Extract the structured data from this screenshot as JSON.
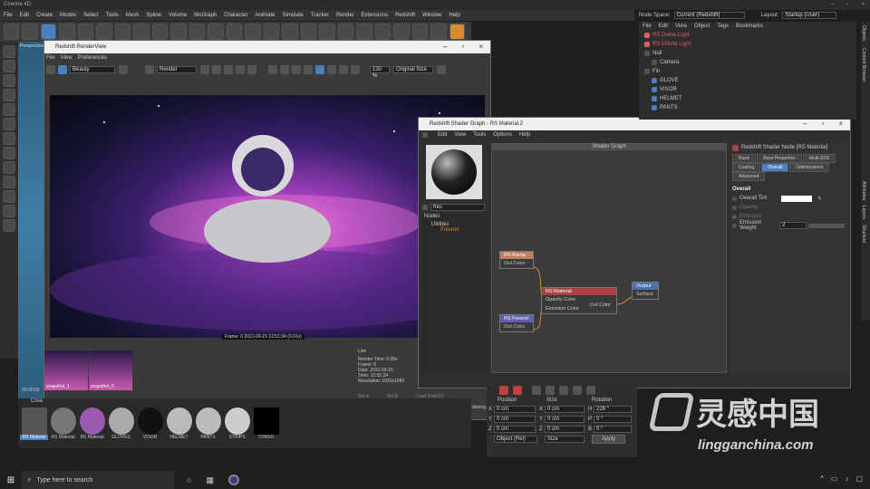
{
  "window_title": "Cinema 4D",
  "menu": [
    "File",
    "Edit",
    "Create",
    "Modes",
    "Select",
    "Tools",
    "Mesh",
    "Spline",
    "Volume",
    "MoGraph",
    "Character",
    "Animate",
    "Simulate",
    "Tracker",
    "Render",
    "Extensions",
    "Redshift",
    "Window",
    "Help"
  ],
  "node_space": {
    "label": "Node Space:",
    "value": "Current (Redshift)"
  },
  "layout": {
    "label": "Layout:",
    "value": "Startup (User)"
  },
  "viewport": {
    "tab": "Perspective",
    "time": "00:00:00"
  },
  "renderview": {
    "title": "Redshift RenderView",
    "menu": [
      "File",
      "View",
      "Preferences"
    ],
    "aov": "Beauty",
    "render_dropdown": "Render",
    "zoom": "130 %",
    "size_mode": "Original Size",
    "frame_caption": "Frame: 0 2021-09-15 12:51:34 (0.01s)",
    "snapshots": [
      {
        "label": "snapshot_1"
      },
      {
        "label": "snapshot_0"
      }
    ],
    "info_lines": [
      "Live",
      "Render Time: 0.00s",
      "Frame: 0",
      "Date: 2021-09-15",
      "Time: 12:51:34",
      "Resolution: 1920x1080"
    ],
    "buttons": [
      "Set A",
      "Set B",
      "Load Post FX"
    ],
    "status": "Progressive Rendering..."
  },
  "shader": {
    "title": "Redshift Shader Graph - RS Material.2",
    "menu": [
      "Edit",
      "View",
      "Tools",
      "Options",
      "Help"
    ],
    "graph_header": "Shader Graph",
    "search": "fres",
    "tree_header": "Nodes",
    "tree": [
      "Utilities",
      "Fresnel"
    ],
    "nodes": {
      "ramp": {
        "title": "RS Ramp",
        "ports": [
          "Out Color"
        ]
      },
      "material": {
        "title": "RS Material",
        "ports": [
          "Opacity Color",
          "Emission Color",
          "Out Color"
        ]
      },
      "fresnel": {
        "title": "RS Fresnel",
        "ports": [
          "Out Color"
        ]
      },
      "output": {
        "title": "Output",
        "ports": [
          "Surface"
        ]
      }
    },
    "attributes": {
      "title": "Redshift Shader Node [RS Material]",
      "tabs": [
        "Basic",
        "Base Properties",
        "Multi-SSS",
        "Coating",
        "Overall",
        "Optimizations",
        "Advanced"
      ],
      "active_tab": "Overall",
      "section": "Overall",
      "fields": [
        {
          "label": "Overall Tint",
          "value": ""
        },
        {
          "label": "Opacity",
          "value": ""
        },
        {
          "label": "Emission",
          "value": ""
        },
        {
          "label": "Emission Weight",
          "value": "2"
        }
      ]
    }
  },
  "objects": {
    "menu": [
      "File",
      "Edit",
      "View",
      "Object",
      "Tags",
      "Bookmarks"
    ],
    "items": [
      {
        "name": "RS Dome Light",
        "color": "#e06060"
      },
      {
        "name": "RS Infinite Light",
        "color": "#e06060"
      },
      {
        "name": "Null",
        "color": "#c8c8c8"
      },
      {
        "name": "Camera",
        "color": "#c8c8c8"
      },
      {
        "name": "Fin",
        "color": "#c8c8c8"
      },
      {
        "name": "GLOVE",
        "color": "#c8c8c8"
      },
      {
        "name": "VISOR",
        "color": "#c8c8c8"
      },
      {
        "name": "HELMET",
        "color": "#c8c8c8"
      },
      {
        "name": "PANTS",
        "color": "#c8c8c8"
      }
    ]
  },
  "materials": {
    "menu": "Crea",
    "items": [
      "RS Material",
      "RS Material",
      "RS Material",
      "GLOVES",
      "VISOR",
      "HELMET",
      "PANTS",
      "STRIPS",
      "TORSO"
    ]
  },
  "coords": {
    "headers": [
      "Position",
      "Size",
      "Rotation"
    ],
    "rows": [
      {
        "axis": "X",
        "pos": "0 cm",
        "size_axis": "X",
        "size": "0 cm",
        "rot_axis": "H",
        "rot": "228 °"
      },
      {
        "axis": "Y",
        "pos": "0 cm",
        "size_axis": "Y",
        "size": "0 cm",
        "rot_axis": "P",
        "rot": "0 °"
      },
      {
        "axis": "Z",
        "pos": "0 cm",
        "size_axis": "Z",
        "size": "0 cm",
        "rot_axis": "B",
        "rot": "0 °"
      }
    ],
    "mode": "Object (Rel)",
    "size_mode": "Size",
    "apply": "Apply"
  },
  "right_tabs": [
    "Objects",
    "Content Browser",
    "Attributes",
    "Layers",
    "Structure"
  ],
  "taskbar": {
    "search_placeholder": "Type here to search"
  },
  "watermark": {
    "logo_text": "灵感中国",
    "url": "lingganchina.com"
  }
}
